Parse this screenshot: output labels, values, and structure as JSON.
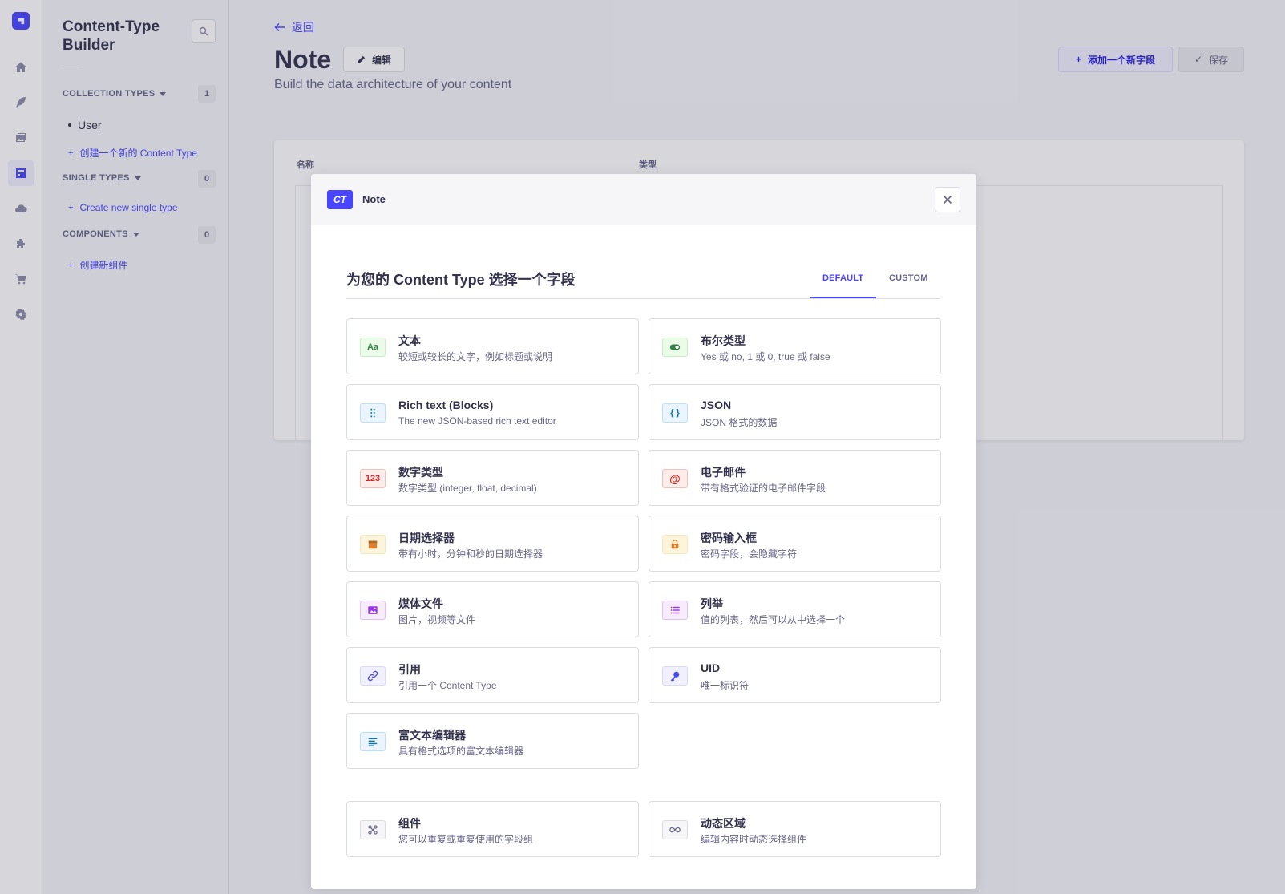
{
  "sidebar": {
    "title": "Content-Type Builder",
    "sections": [
      {
        "label": "COLLECTION TYPES",
        "count": "1"
      },
      {
        "label": "SINGLE TYPES",
        "count": "0"
      },
      {
        "label": "COMPONENTS",
        "count": "0"
      }
    ],
    "collection_items": [
      "User"
    ],
    "create_collection": "创建一个新的 Content Type",
    "create_single": "Create new single type",
    "create_component": "创建新组件"
  },
  "header": {
    "back": "返回",
    "title": "Note",
    "edit": "编辑",
    "subtitle": "Build the data architecture of your content",
    "add_field": "添加一个新字段",
    "save": "保存"
  },
  "table": {
    "col_name": "名称",
    "col_type": "类型"
  },
  "modal": {
    "badge": "CT",
    "crumb": "Note",
    "heading": "为您的 Content Type 选择一个字段",
    "tabs": [
      "DEFAULT",
      "CUSTOM"
    ],
    "fields": [
      {
        "icon": "text-icon",
        "glyph": "Aa",
        "name": "文本",
        "desc": "较短或较长的文字，例如标题或说明",
        "color": "#328048"
      },
      {
        "icon": "boolean-icon",
        "glyph": "",
        "name": "布尔类型",
        "desc": "Yes 或 no, 1 或 0, true 或 false",
        "color": "#328048"
      },
      {
        "icon": "blocks-icon",
        "glyph": "",
        "name": "Rich text (Blocks)",
        "desc": "The new JSON-based rich text editor",
        "color": "#0c75af"
      },
      {
        "icon": "json-icon",
        "glyph": "{ }",
        "name": "JSON",
        "desc": "JSON 格式的数据",
        "color": "#0c75af"
      },
      {
        "icon": "number-icon",
        "glyph": "123",
        "name": "数字类型",
        "desc": "数字类型 (integer, float, decimal)",
        "color": "#d02b20"
      },
      {
        "icon": "email-icon",
        "glyph": "@",
        "name": "电子邮件",
        "desc": "带有格式验证的电子邮件字段",
        "color": "#d02b20"
      },
      {
        "icon": "date-icon",
        "glyph": "",
        "name": "日期选择器",
        "desc": "带有小时，分钟和秒的日期选择器",
        "color": "#d9822f"
      },
      {
        "icon": "password-icon",
        "glyph": "",
        "name": "密码输入框",
        "desc": "密码字段，会隐藏字符",
        "color": "#d9822f"
      },
      {
        "icon": "media-icon",
        "glyph": "",
        "name": "媒体文件",
        "desc": "图片，视频等文件",
        "color": "#9736e8"
      },
      {
        "icon": "enumeration-icon",
        "glyph": "",
        "name": "列举",
        "desc": "值的列表，然后可以从中选择一个",
        "color": "#9736e8"
      },
      {
        "icon": "relation-icon",
        "glyph": "",
        "name": "引用",
        "desc": "引用一个 Content Type",
        "color": "#4945ff"
      },
      {
        "icon": "uid-icon",
        "glyph": "",
        "name": "UID",
        "desc": "唯一标识符",
        "color": "#4945ff"
      },
      {
        "icon": "richtext-icon",
        "glyph": "",
        "name": "富文本编辑器",
        "desc": "具有格式选项的富文本编辑器",
        "color": "#0c75af"
      }
    ],
    "extra_fields": [
      {
        "icon": "component-icon",
        "name": "组件",
        "desc": "您可以重复或重复使用的字段组"
      },
      {
        "icon": "dynamic-zone-icon",
        "name": "动态区域",
        "desc": "编辑内容时动态选择组件"
      }
    ]
  }
}
